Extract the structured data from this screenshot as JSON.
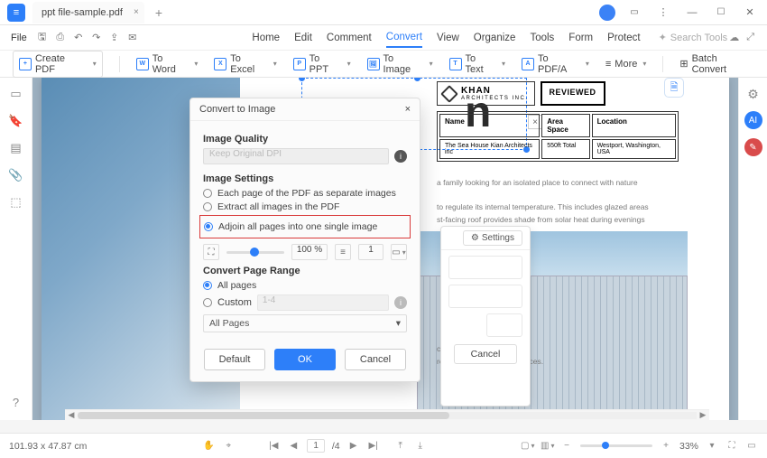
{
  "titlebar": {
    "tab_name": "ppt file-sample.pdf"
  },
  "menu": {
    "file": "File",
    "items": [
      "Home",
      "Edit",
      "Comment",
      "Convert",
      "View",
      "Organize",
      "Tools",
      "Form",
      "Protect"
    ],
    "active_index": 3,
    "search_placeholder": "Search Tools"
  },
  "ribbon": {
    "create": "Create PDF",
    "to_word": "To Word",
    "to_excel": "To Excel",
    "to_ppt": "To PPT",
    "to_image": "To Image",
    "to_text": "To Text",
    "to_pdfa": "To PDF/A",
    "more": "More",
    "batch": "Batch Convert"
  },
  "dialog": {
    "title": "Convert to Image",
    "image_quality": "Image Quality",
    "dpi_placeholder": "Keep Original DPI",
    "image_settings": "Image Settings",
    "opt_each": "Each page of the PDF as separate images",
    "opt_extract": "Extract all images in the PDF",
    "opt_adjoin": "Adjoin all pages into one single image",
    "zoom_pct": "100 %",
    "spin_val": "1",
    "range_h": "Convert Page Range",
    "opt_all": "All pages",
    "opt_custom": "Custom",
    "custom_hint": "1-4",
    "select_all": "All Pages",
    "btn_default": "Default",
    "btn_ok": "OK",
    "btn_cancel": "Cancel"
  },
  "settings_pop": {
    "settings": "Settings",
    "cancel": "Cancel"
  },
  "document": {
    "khan": "KHAN",
    "khan_sub": "ARCHITECTS INC.",
    "reviewed": "REVIEWED",
    "h_name": "Name",
    "v_name": "The Sea House Kian Architects inc",
    "h_area": "Area Space",
    "v_area": "550ft Total",
    "h_loc": "Location",
    "v_loc": "Westport, Washington, USA",
    "body_a": "a family looking for an isolated place to connect with nature",
    "body_b": "to regulate its internal temperature. This includes glazed areas",
    "body_c": "st-facing roof provides shade from solar heat during evenings",
    "body_d": "community through work, research and personal choices."
  },
  "status": {
    "dims": "101.93 x 47.87 cm",
    "page": "1",
    "page_total": "/4",
    "zoom": "33%"
  }
}
